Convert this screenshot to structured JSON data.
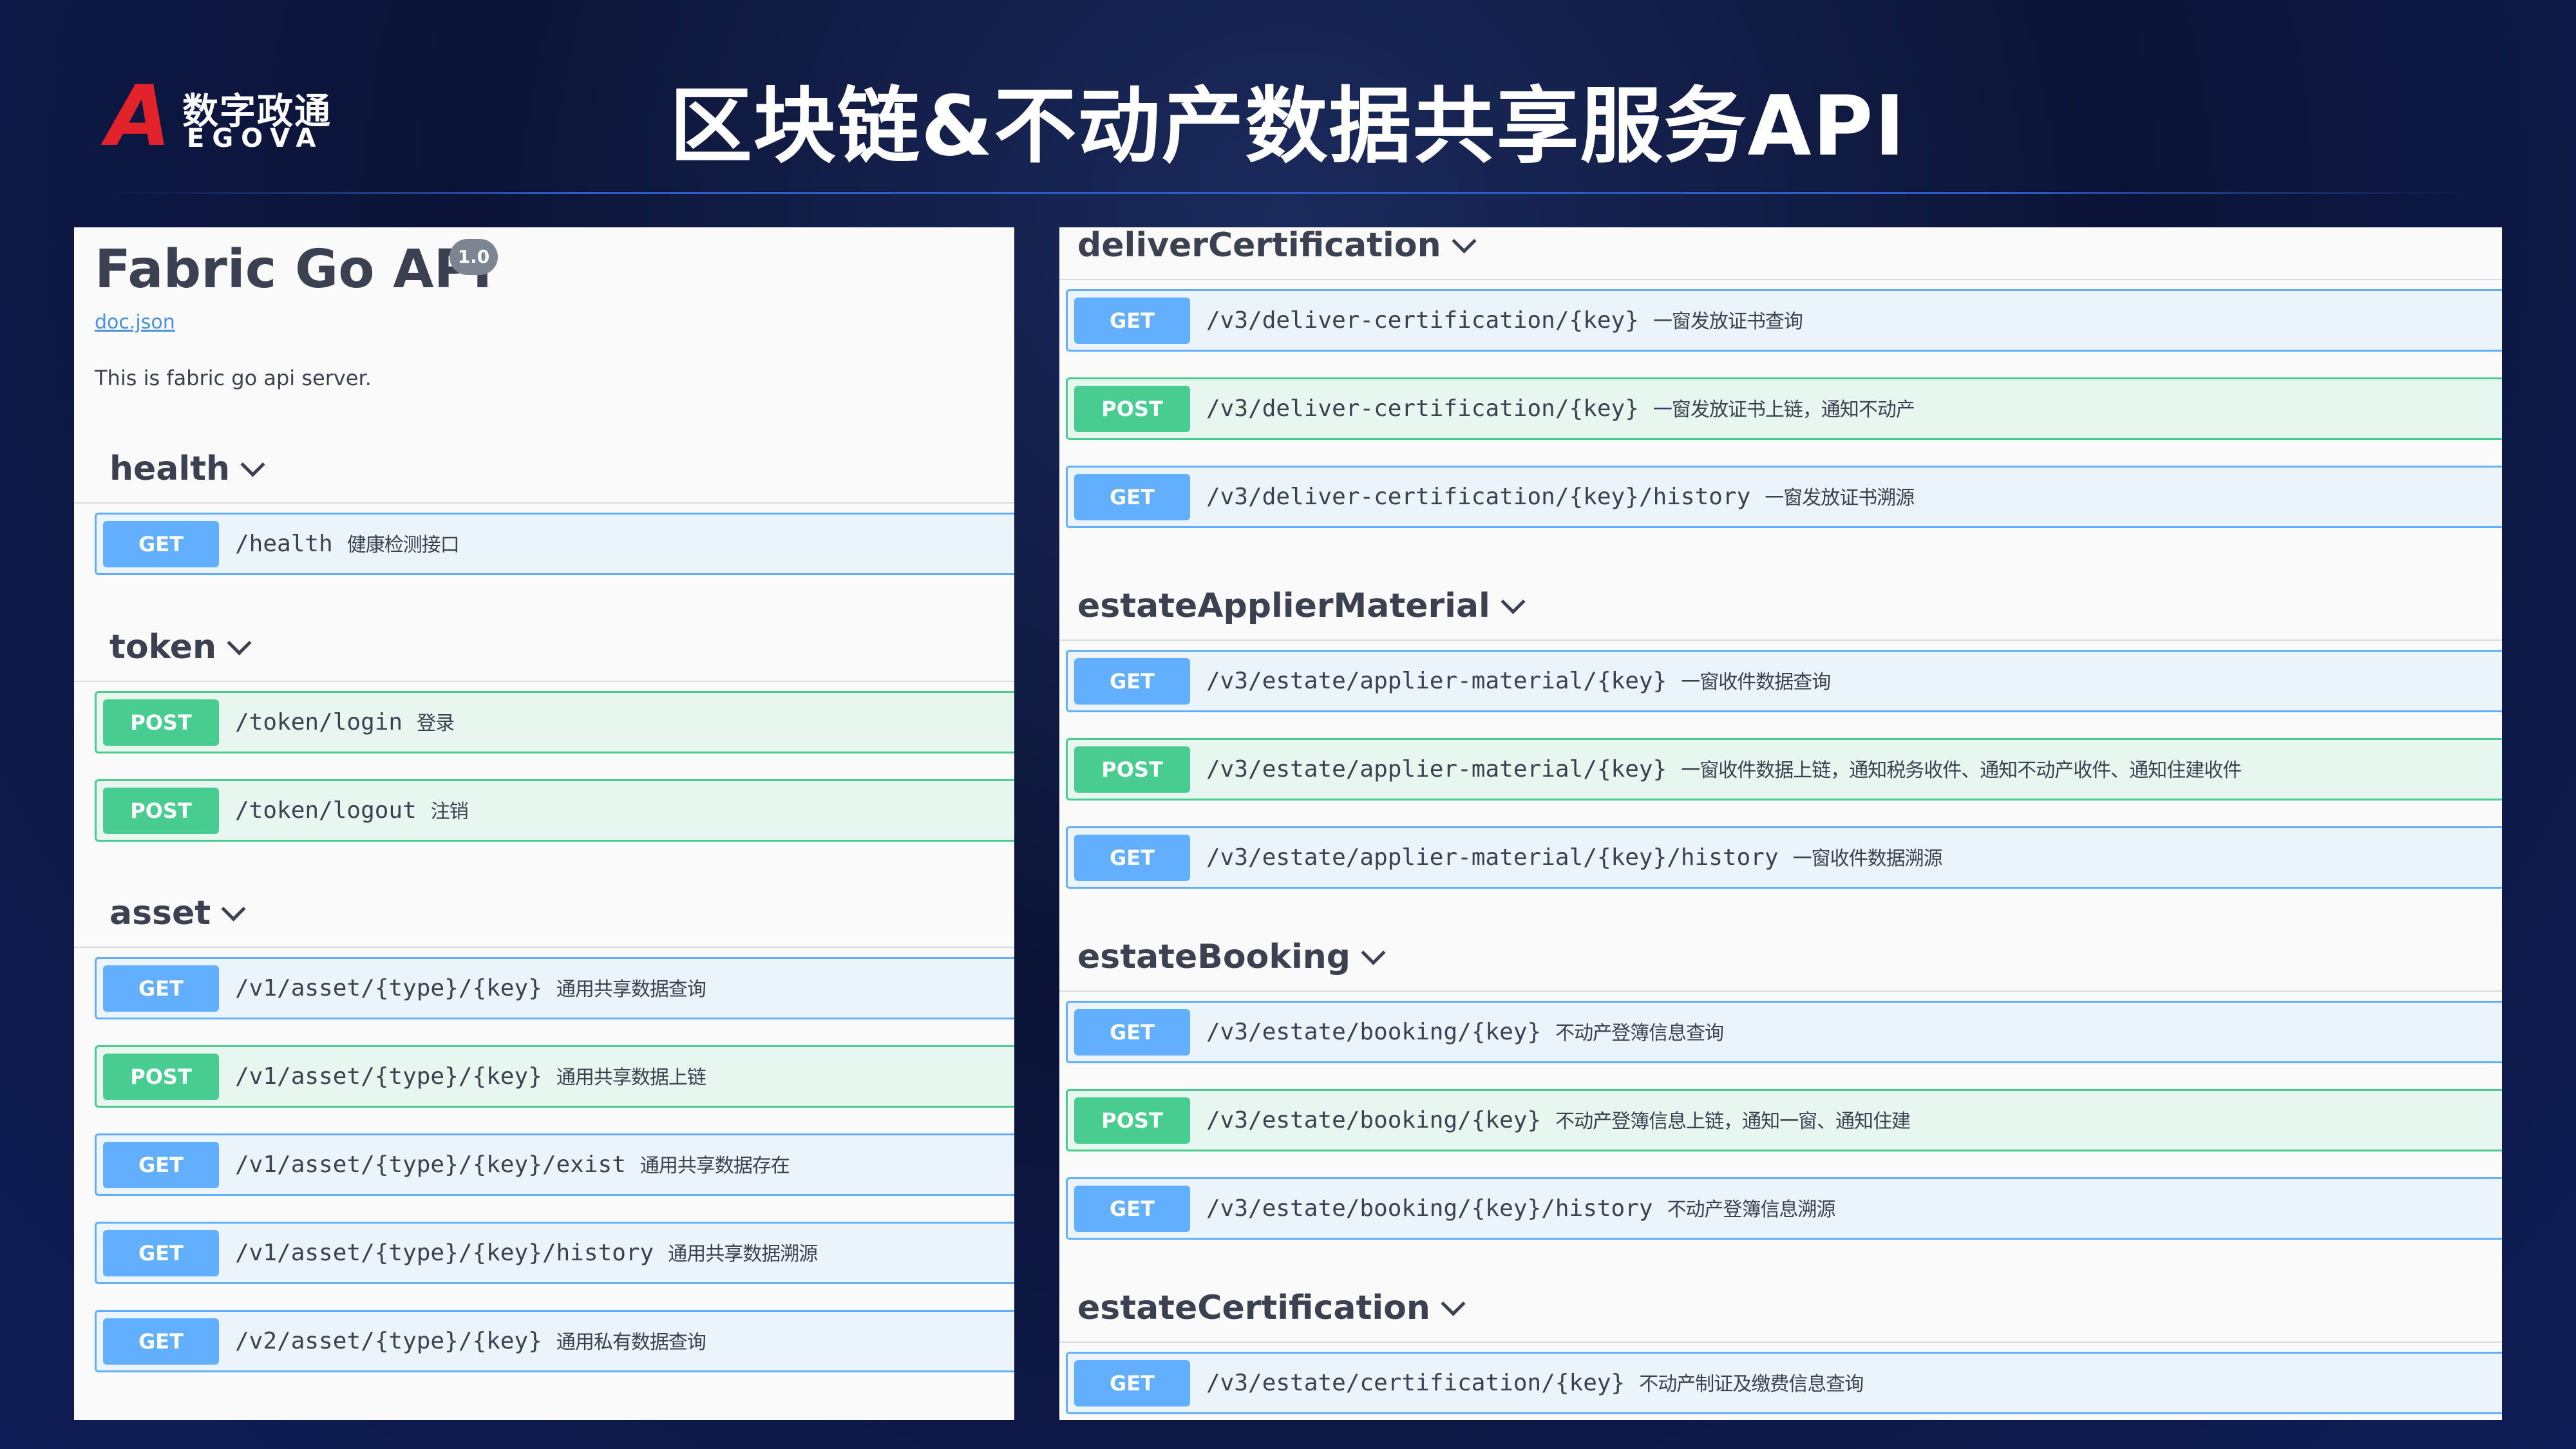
{
  "header": {
    "logo_letter": "A",
    "logo_cn": "数字政通",
    "logo_en": "EGOVA",
    "title": "区块链&不动产数据共享服务API"
  },
  "left_panel": {
    "api_title": "Fabric Go API",
    "version": "1.0",
    "doc_link": "doc.json",
    "description": "This is fabric go api server.",
    "sections": [
      {
        "name": "health",
        "ops": [
          {
            "method": "GET",
            "path": "/health",
            "summary": "健康检测接口"
          }
        ]
      },
      {
        "name": "token",
        "ops": [
          {
            "method": "POST",
            "path": "/token/login",
            "summary": "登录"
          },
          {
            "method": "POST",
            "path": "/token/logout",
            "summary": "注销"
          }
        ]
      },
      {
        "name": "asset",
        "ops": [
          {
            "method": "GET",
            "path": "/v1/asset/{type}/{key}",
            "summary": "通用共享数据查询"
          },
          {
            "method": "POST",
            "path": "/v1/asset/{type}/{key}",
            "summary": "通用共享数据上链"
          },
          {
            "method": "GET",
            "path": "/v1/asset/{type}/{key}/exist",
            "summary": "通用共享数据存在"
          },
          {
            "method": "GET",
            "path": "/v1/asset/{type}/{key}/history",
            "summary": "通用共享数据溯源"
          },
          {
            "method": "GET",
            "path": "/v2/asset/{type}/{key}",
            "summary": "通用私有数据查询"
          }
        ]
      }
    ]
  },
  "right_panel": {
    "sections": [
      {
        "name": "deliverCertification",
        "ops": [
          {
            "method": "GET",
            "path": "/v3/deliver-certification/{key}",
            "summary": "一窗发放证书查询"
          },
          {
            "method": "POST",
            "path": "/v3/deliver-certification/{key}",
            "summary": "一窗发放证书上链，通知不动产"
          },
          {
            "method": "GET",
            "path": "/v3/deliver-certification/{key}/history",
            "summary": "一窗发放证书溯源"
          }
        ]
      },
      {
        "name": "estateApplierMaterial",
        "ops": [
          {
            "method": "GET",
            "path": "/v3/estate/applier-material/{key}",
            "summary": "一窗收件数据查询"
          },
          {
            "method": "POST",
            "path": "/v3/estate/applier-material/{key}",
            "summary": "一窗收件数据上链，通知税务收件、通知不动产收件、通知住建收件"
          },
          {
            "method": "GET",
            "path": "/v3/estate/applier-material/{key}/history",
            "summary": "一窗收件数据溯源"
          }
        ]
      },
      {
        "name": "estateBooking",
        "ops": [
          {
            "method": "GET",
            "path": "/v3/estate/booking/{key}",
            "summary": "不动产登簿信息查询"
          },
          {
            "method": "POST",
            "path": "/v3/estate/booking/{key}",
            "summary": "不动产登簿信息上链，通知一窗、通知住建"
          },
          {
            "method": "GET",
            "path": "/v3/estate/booking/{key}/history",
            "summary": "不动产登簿信息溯源"
          }
        ]
      },
      {
        "name": "estateCertification",
        "ops": [
          {
            "method": "GET",
            "path": "/v3/estate/certification/{key}",
            "summary": "不动产制证及缴费信息查询"
          }
        ]
      }
    ]
  }
}
